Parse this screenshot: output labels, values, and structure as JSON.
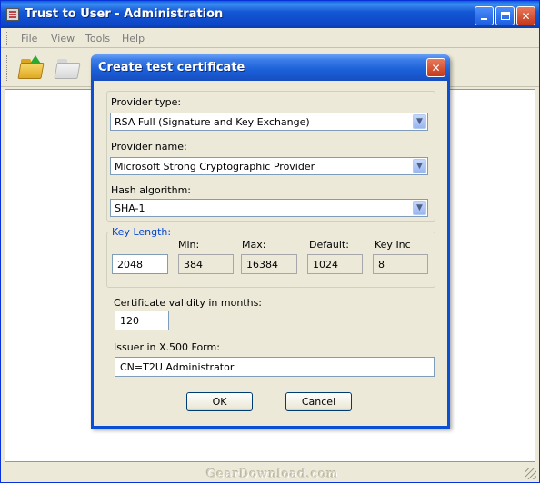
{
  "window": {
    "title": "Trust to User - Administration"
  },
  "menu": [
    "File",
    "View",
    "Tools",
    "Help"
  ],
  "dialog": {
    "title": "Create test certificate",
    "provider_type": {
      "label": "Provider type:",
      "value": "RSA Full (Signature and Key Exchange)"
    },
    "provider_name": {
      "label": "Provider name:",
      "value": "Microsoft Strong Cryptographic Provider"
    },
    "hash_algorithm": {
      "label": "Hash algorithm:",
      "value": "SHA-1"
    },
    "key_length": {
      "legend": "Key Length:",
      "value": "2048",
      "min_label": "Min:",
      "min_value": "384",
      "max_label": "Max:",
      "max_value": "16384",
      "default_label": "Default:",
      "default_value": "1024",
      "inc_label": "Key Inc",
      "inc_value": "8"
    },
    "validity": {
      "label": "Certificate validity in months:",
      "value": "120"
    },
    "issuer": {
      "label": "Issuer in X.500 Form:",
      "value": "CN=T2U Administrator"
    },
    "ok_label": "OK",
    "cancel_label": "Cancel"
  },
  "watermark": "GearDownload.com",
  "colors": {
    "titlebar": "#0a4fd4",
    "accent_label": "#0046d5"
  }
}
